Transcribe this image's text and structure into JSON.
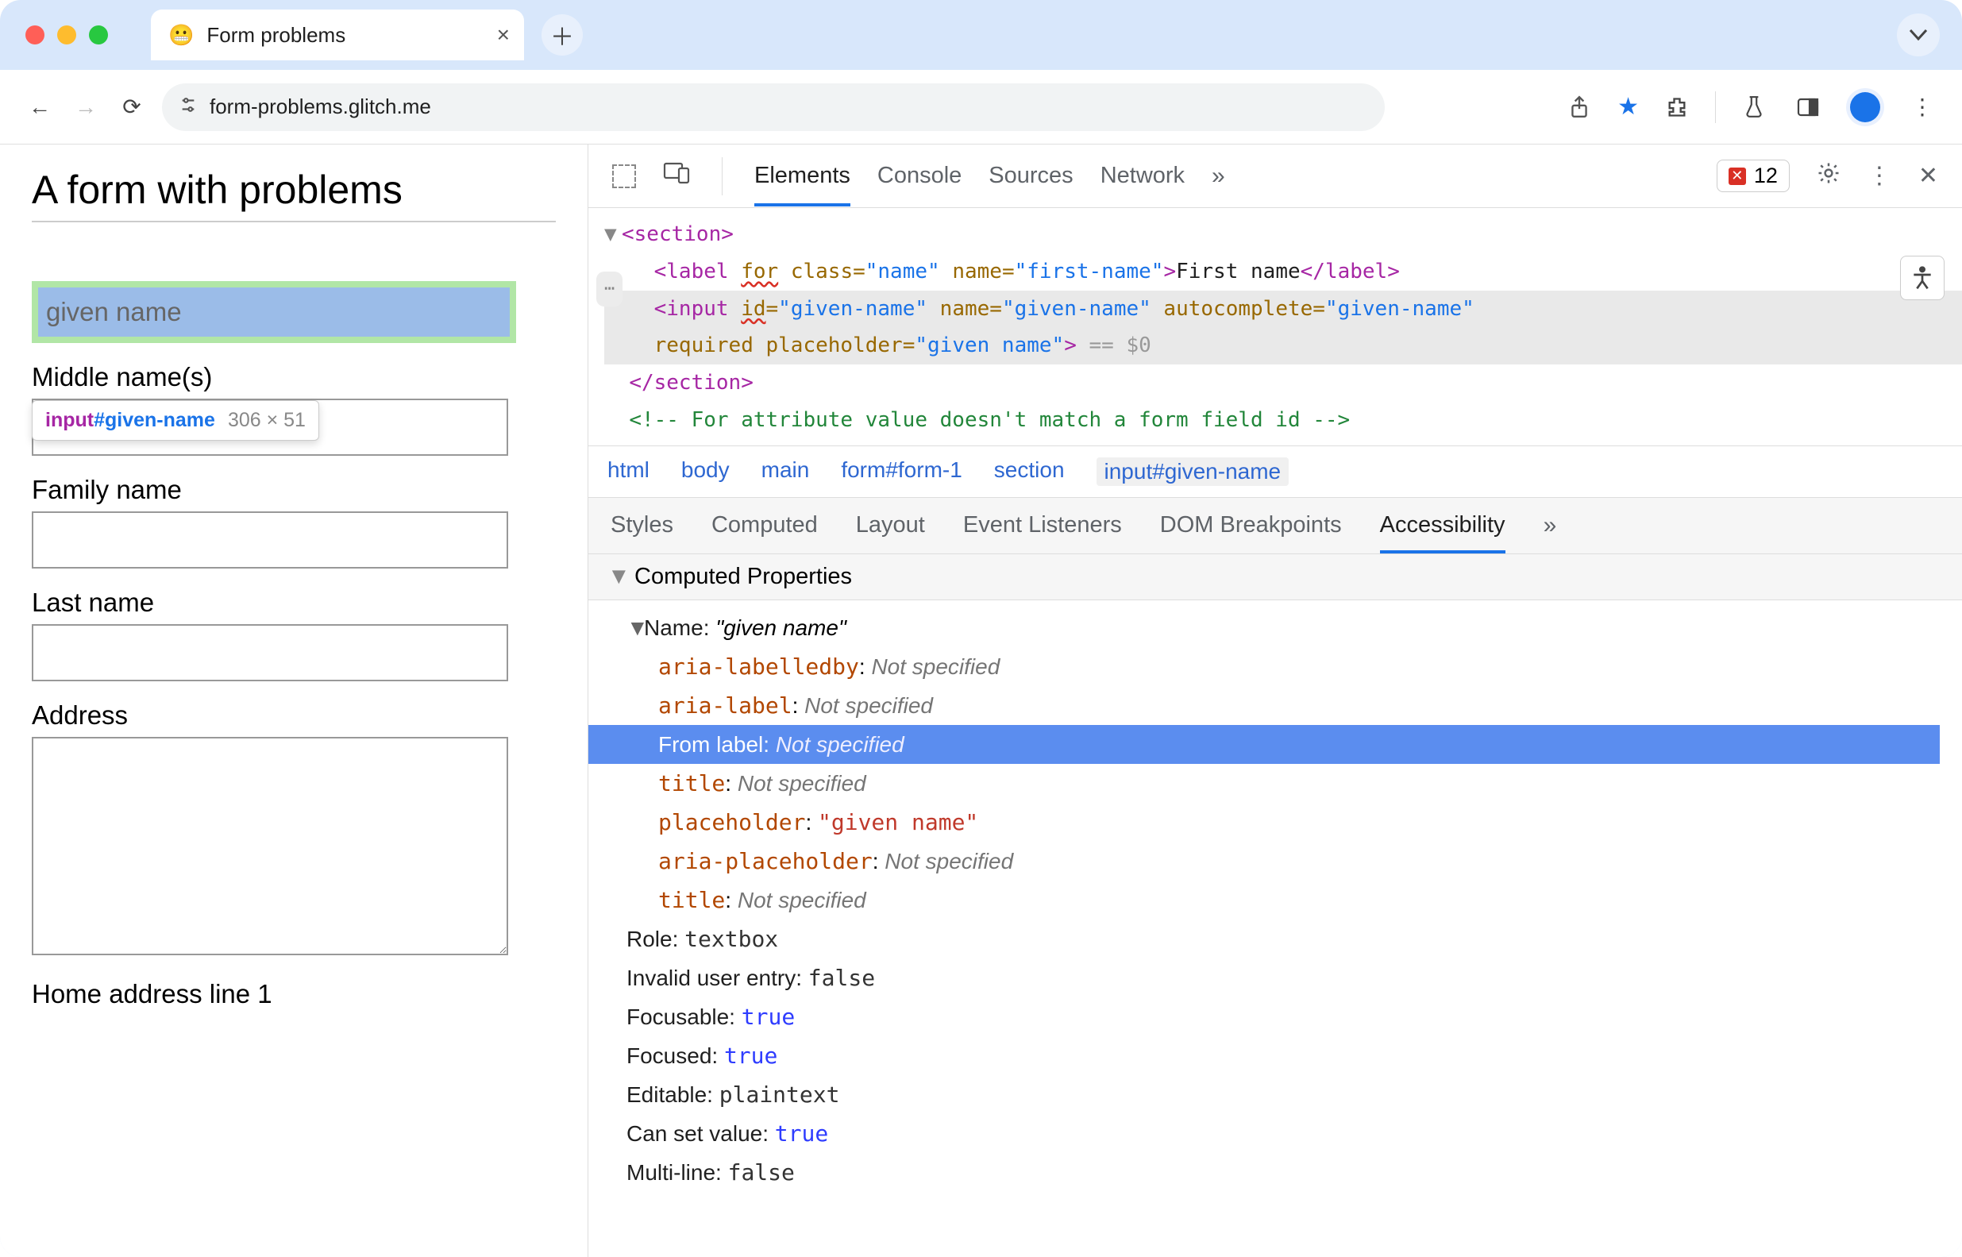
{
  "tab": {
    "title": "Form problems",
    "favicon": "😬"
  },
  "url": "form-problems.glitch.me",
  "error_count": "12",
  "inspect_tooltip": {
    "tag": "input",
    "id": "#given-name",
    "dims": "306 × 51"
  },
  "page": {
    "heading": "A form with problems",
    "given_name_placeholder": "given name",
    "labels": {
      "middle": "Middle name(s)",
      "family": "Family name",
      "last": "Last name",
      "address": "Address",
      "home1": "Home address line 1"
    }
  },
  "devtools_tabs": {
    "elements": "Elements",
    "console": "Console",
    "sources": "Sources",
    "network": "Network"
  },
  "dom": {
    "section_open": "<section>",
    "label_line_1": "<label ",
    "label_for": "for",
    "label_line_2": " class=",
    "label_class_val": "\"name\"",
    "label_line_3": " name=",
    "label_name_val": "\"first-name\"",
    "label_line_4": ">First name</label>",
    "input_line_1": "<input ",
    "input_id": "id",
    "input_line_2": "=",
    "input_id_val": "\"given-name\"",
    "input_line_3": " name=",
    "input_name_val": "\"given-name\"",
    "input_line_4": " autocomplete=",
    "input_ac_val": "\"given-name\"",
    "input_line_5": "required placeholder=",
    "input_ph_val": "\"given name\"",
    "input_line_6": ">",
    "eq_dollar": " == $0",
    "section_close": "</section>",
    "comment": "<!-- For attribute value doesn't match a form field id -->"
  },
  "crumbs": [
    "html",
    "body",
    "main",
    "form#form-1",
    "section",
    "input#given-name"
  ],
  "subtabs": {
    "styles": "Styles",
    "computed": "Computed",
    "layout": "Layout",
    "listeners": "Event Listeners",
    "dombp": "DOM Breakpoints",
    "a11y": "Accessibility"
  },
  "computed_hdr": "Computed Properties",
  "props": {
    "name_label": "Name: ",
    "name_value": "\"given name\"",
    "aria_labelledby_k": "aria-labelledby",
    "aria_label_k": "aria-label",
    "from_label_k": "From label: ",
    "title_k": "title",
    "placeholder_k": "placeholder",
    "placeholder_v": "\"given name\"",
    "aria_placeholder_k": "aria-placeholder",
    "not_specified": "Not specified",
    "role_k": "Role: ",
    "role_v": "textbox",
    "invalid_k": "Invalid user entry: ",
    "invalid_v": "false",
    "focusable_k": "Focusable: ",
    "focusable_v": "true",
    "focused_k": "Focused: ",
    "focused_v": "true",
    "editable_k": "Editable: ",
    "editable_v": "plaintext",
    "cansetvalue_k": "Can set value: ",
    "cansetvalue_v": "true",
    "multiline_k": "Multi-line: ",
    "multiline_v": "false"
  }
}
